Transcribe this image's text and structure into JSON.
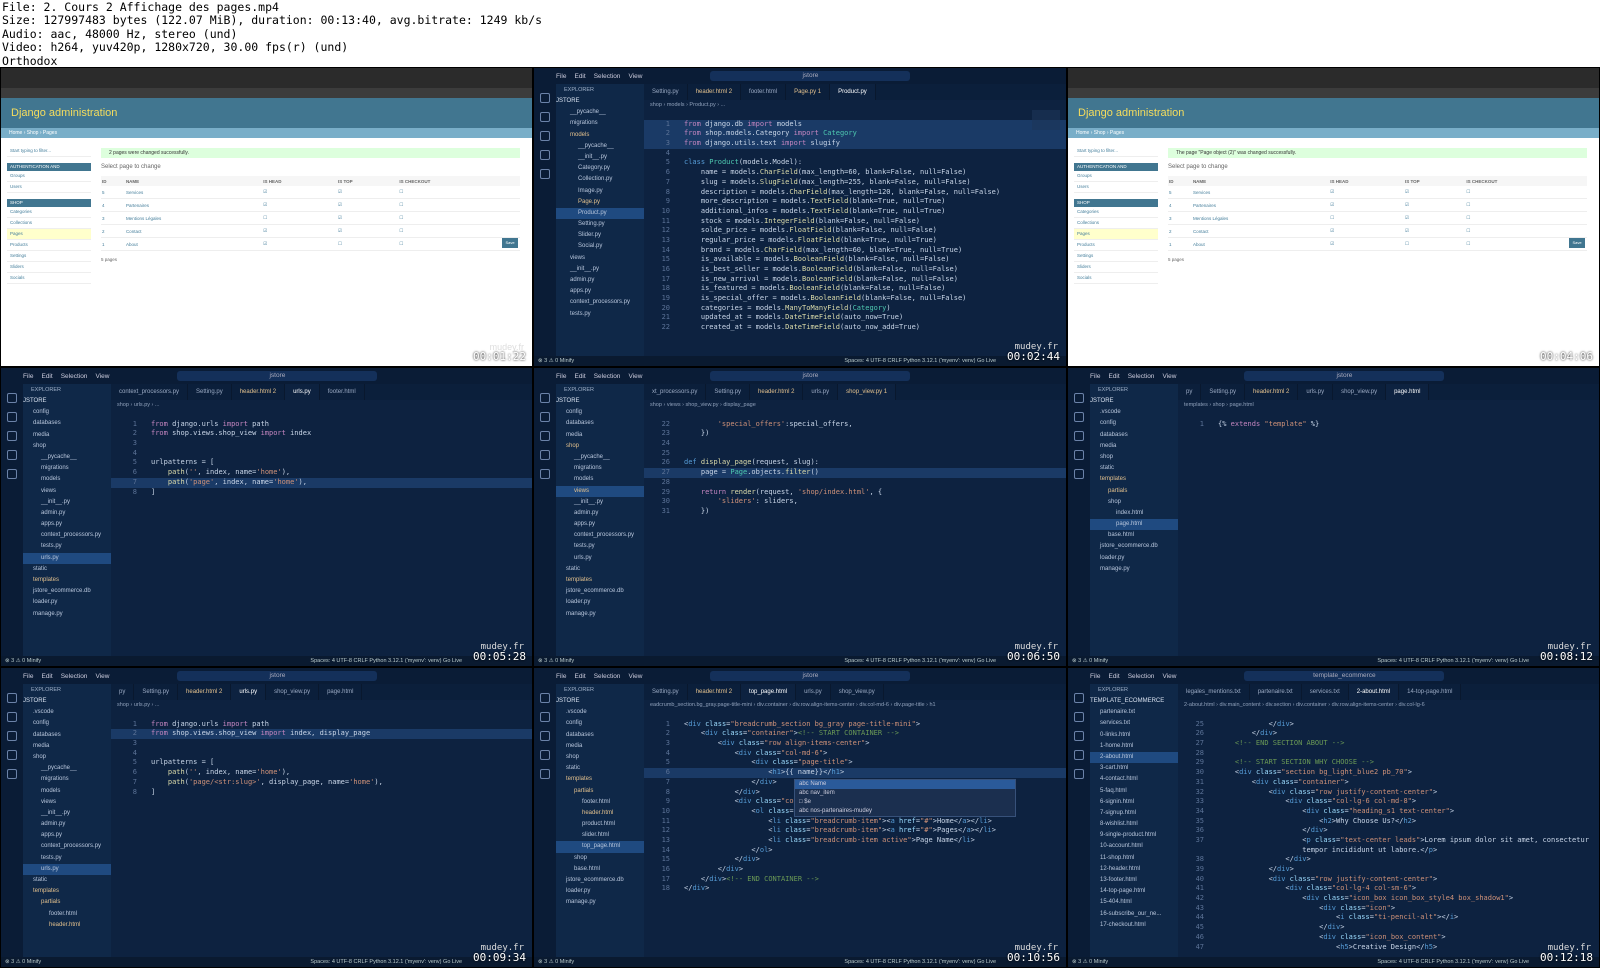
{
  "header": {
    "file": "File: 2. Cours 2 Affichage des pages.mp4",
    "size": "Size: 127997483 bytes (122.07 MiB), duration: 00:13:40, avg.bitrate: 1249 kb/s",
    "audio": "Audio: aac, 48000 Hz, stereo (und)",
    "video": "Video: h264, yuv420p, 1280x720, 30.00 fps(r) (und)",
    "author": "Orthodox"
  },
  "watermark": "mudey.fr",
  "timestamps": [
    "00:01:22",
    "00:02:44",
    "00:04:06",
    "00:05:28",
    "00:06:50",
    "00:08:12",
    "00:09:34",
    "00:10:56",
    "00:12:18"
  ],
  "django": {
    "title": "Django administration",
    "breadcrumb": "Home › Shop › Pages",
    "msg1": "2 pages were changed successfully.",
    "msg2": "The page \"Page object (2)\" was changed successfully.",
    "heading": "Select page to change",
    "filter": "Start typing to filter...",
    "group_auth": "AUTHENTICATION AND AUTHORIZATION",
    "group_shop": "SHOP",
    "auth_items": [
      "Groups",
      "Users"
    ],
    "shop_items": [
      "Categories",
      "Collections",
      "Pages",
      "Products",
      "Settings",
      "Sliders",
      "Socials"
    ],
    "columns": [
      "ID",
      "NAME",
      "IS HEAD",
      "IS TOP",
      "IS CHECKOUT"
    ],
    "rows": [
      {
        "id": "5",
        "name": "Services"
      },
      {
        "id": "4",
        "name": "Partenaires"
      },
      {
        "id": "3",
        "name": "Mentions Légales"
      },
      {
        "id": "2",
        "name": "Contact"
      },
      {
        "id": "1",
        "name": "About"
      }
    ],
    "count": "5 pages",
    "save": "Save"
  },
  "vscode": {
    "menu": [
      "File",
      "Edit",
      "Selection",
      "View"
    ],
    "search1": "jstore",
    "search2": "template_ecommerce",
    "explorer": "EXPLORER",
    "outline": "OUTLINE",
    "status_left": "⊗ 3 ⚠ 0   Minify",
    "status_right": "Spaces: 4   UTF-8   CRLF   Python   3.12.1 ('myenv': venv)   Go Live",
    "p2": {
      "tabs": [
        "Setting.py",
        "header.html 2",
        "footer.html",
        "Page.py 1",
        "Product.py"
      ],
      "bc": "shop › models › Product.py › ...",
      "files": [
        "JSTORE",
        "__pycache__",
        "migrations",
        "models",
        "__pycache__",
        "__init__.py",
        "Category.py",
        "Collection.py",
        "Image.py",
        "Page.py",
        "Product.py",
        "Setting.py",
        "Slider.py",
        "Social.py",
        "views",
        "__init__.py",
        "admin.py",
        "apps.py",
        "context_processors.py",
        "tests.py",
        "urls.py"
      ]
    },
    "p4": {
      "tabs": [
        "context_processors.py",
        "Setting.py",
        "header.html 2",
        "urls.py",
        "footer.html"
      ],
      "bc": "shop › urls.py › ...",
      "files": [
        "JSTORE",
        "config",
        "databases",
        "media",
        "shop",
        "__pycache__",
        "migrations",
        "models",
        "views",
        "__init__.py",
        "admin.py",
        "apps.py",
        "context_processors.py",
        "tests.py",
        "urls.py",
        "static",
        "templates",
        "jstore_ecommerce.db",
        "loader.py",
        "manage.py"
      ]
    },
    "p5": {
      "tabs": [
        "xt_processors.py",
        "Setting.py",
        "header.html 2",
        "urls.py",
        "shop_view.py 1"
      ],
      "bc": "shop › views › shop_view.py › display_page",
      "files": [
        "JSTORE",
        "config",
        "databases",
        "media",
        "shop",
        "__pycache__",
        "migrations",
        "models",
        "views",
        "__init__.py",
        "admin.py",
        "apps.py",
        "context_processors.py",
        "tests.py",
        "urls.py",
        "static",
        "templates",
        "jstore_ecommerce.db",
        "loader.py",
        "manage.py"
      ]
    },
    "p6": {
      "tabs": [
        "py",
        "Setting.py",
        "header.html 2",
        "urls.py",
        "shop_view.py",
        "page.html"
      ],
      "bc": "templates › shop › page.html",
      "files": [
        "JSTORE",
        ".vscode",
        "config",
        "databases",
        "media",
        "shop",
        "static",
        "templates",
        "partials",
        "shop",
        "index.html",
        "page.html",
        "base.html",
        "jstore_ecommerce.db",
        "loader.py",
        "manage.py"
      ]
    },
    "p7": {
      "tabs": [
        "py",
        "Setting.py",
        "header.html 2",
        "urls.py",
        "shop_view.py",
        "page.html"
      ],
      "bc": "shop › urls.py › ...",
      "files": [
        "JSTORE",
        ".vscode",
        "config",
        "databases",
        "media",
        "shop",
        "__pycache__",
        "migrations",
        "models",
        "views",
        "__init__.py",
        "admin.py",
        "apps.py",
        "context_processors.py",
        "tests.py",
        "urls.py",
        "static",
        "templates",
        "partials",
        "footer.html",
        "header.html"
      ]
    },
    "p8": {
      "tabs": [
        "Setting.py",
        "header.html 2",
        "top_page.html",
        "urls.py",
        "shop_view.py"
      ],
      "bc": "eadcrumb_section.bg_gray.page-title-mini › div.container › div.row.align-items-center › div.col-md-6 › div.page-title › h1",
      "files": [
        "JSTORE",
        ".vscode",
        "config",
        "databases",
        "media",
        "shop",
        "static",
        "templates",
        "partials",
        "footer.html",
        "header.html",
        "product.html",
        "slider.html",
        "top_page.html",
        "shop",
        "base.html",
        "jstore_ecommerce.db",
        "loader.py",
        "manage.py"
      ],
      "suggest": [
        "abc Name",
        "abc nav_item",
        "□ $e",
        "abc nos-partenaires-mudey"
      ]
    },
    "p9": {
      "tabs": [
        "legales_mentions.txt",
        "partenaire.txt",
        "services.txt",
        "2-about.html",
        "14-top-page.html"
      ],
      "bc": "2-about.html › div.main_content › div.section › div.container › div.row.align-items-center › div.col-lg-6",
      "files": [
        "TEMPLATE_ECOMMERCE",
        "partenaire.txt",
        "services.txt",
        "0-links.html",
        "1-home.html",
        "2-about.html",
        "3-cart.html",
        "4-contact.html",
        "5-faq.html",
        "6-signin.html",
        "7-signup.html",
        "8-wishlist.html",
        "9-single-product.html",
        "10-account.html",
        "11-shop.html",
        "12-header.html",
        "13-footer.html",
        "14-top-page.html",
        "15-404.html",
        "16-subscribe_our_ne...",
        "17-checkout.html",
        "18-compare.html"
      ]
    }
  }
}
